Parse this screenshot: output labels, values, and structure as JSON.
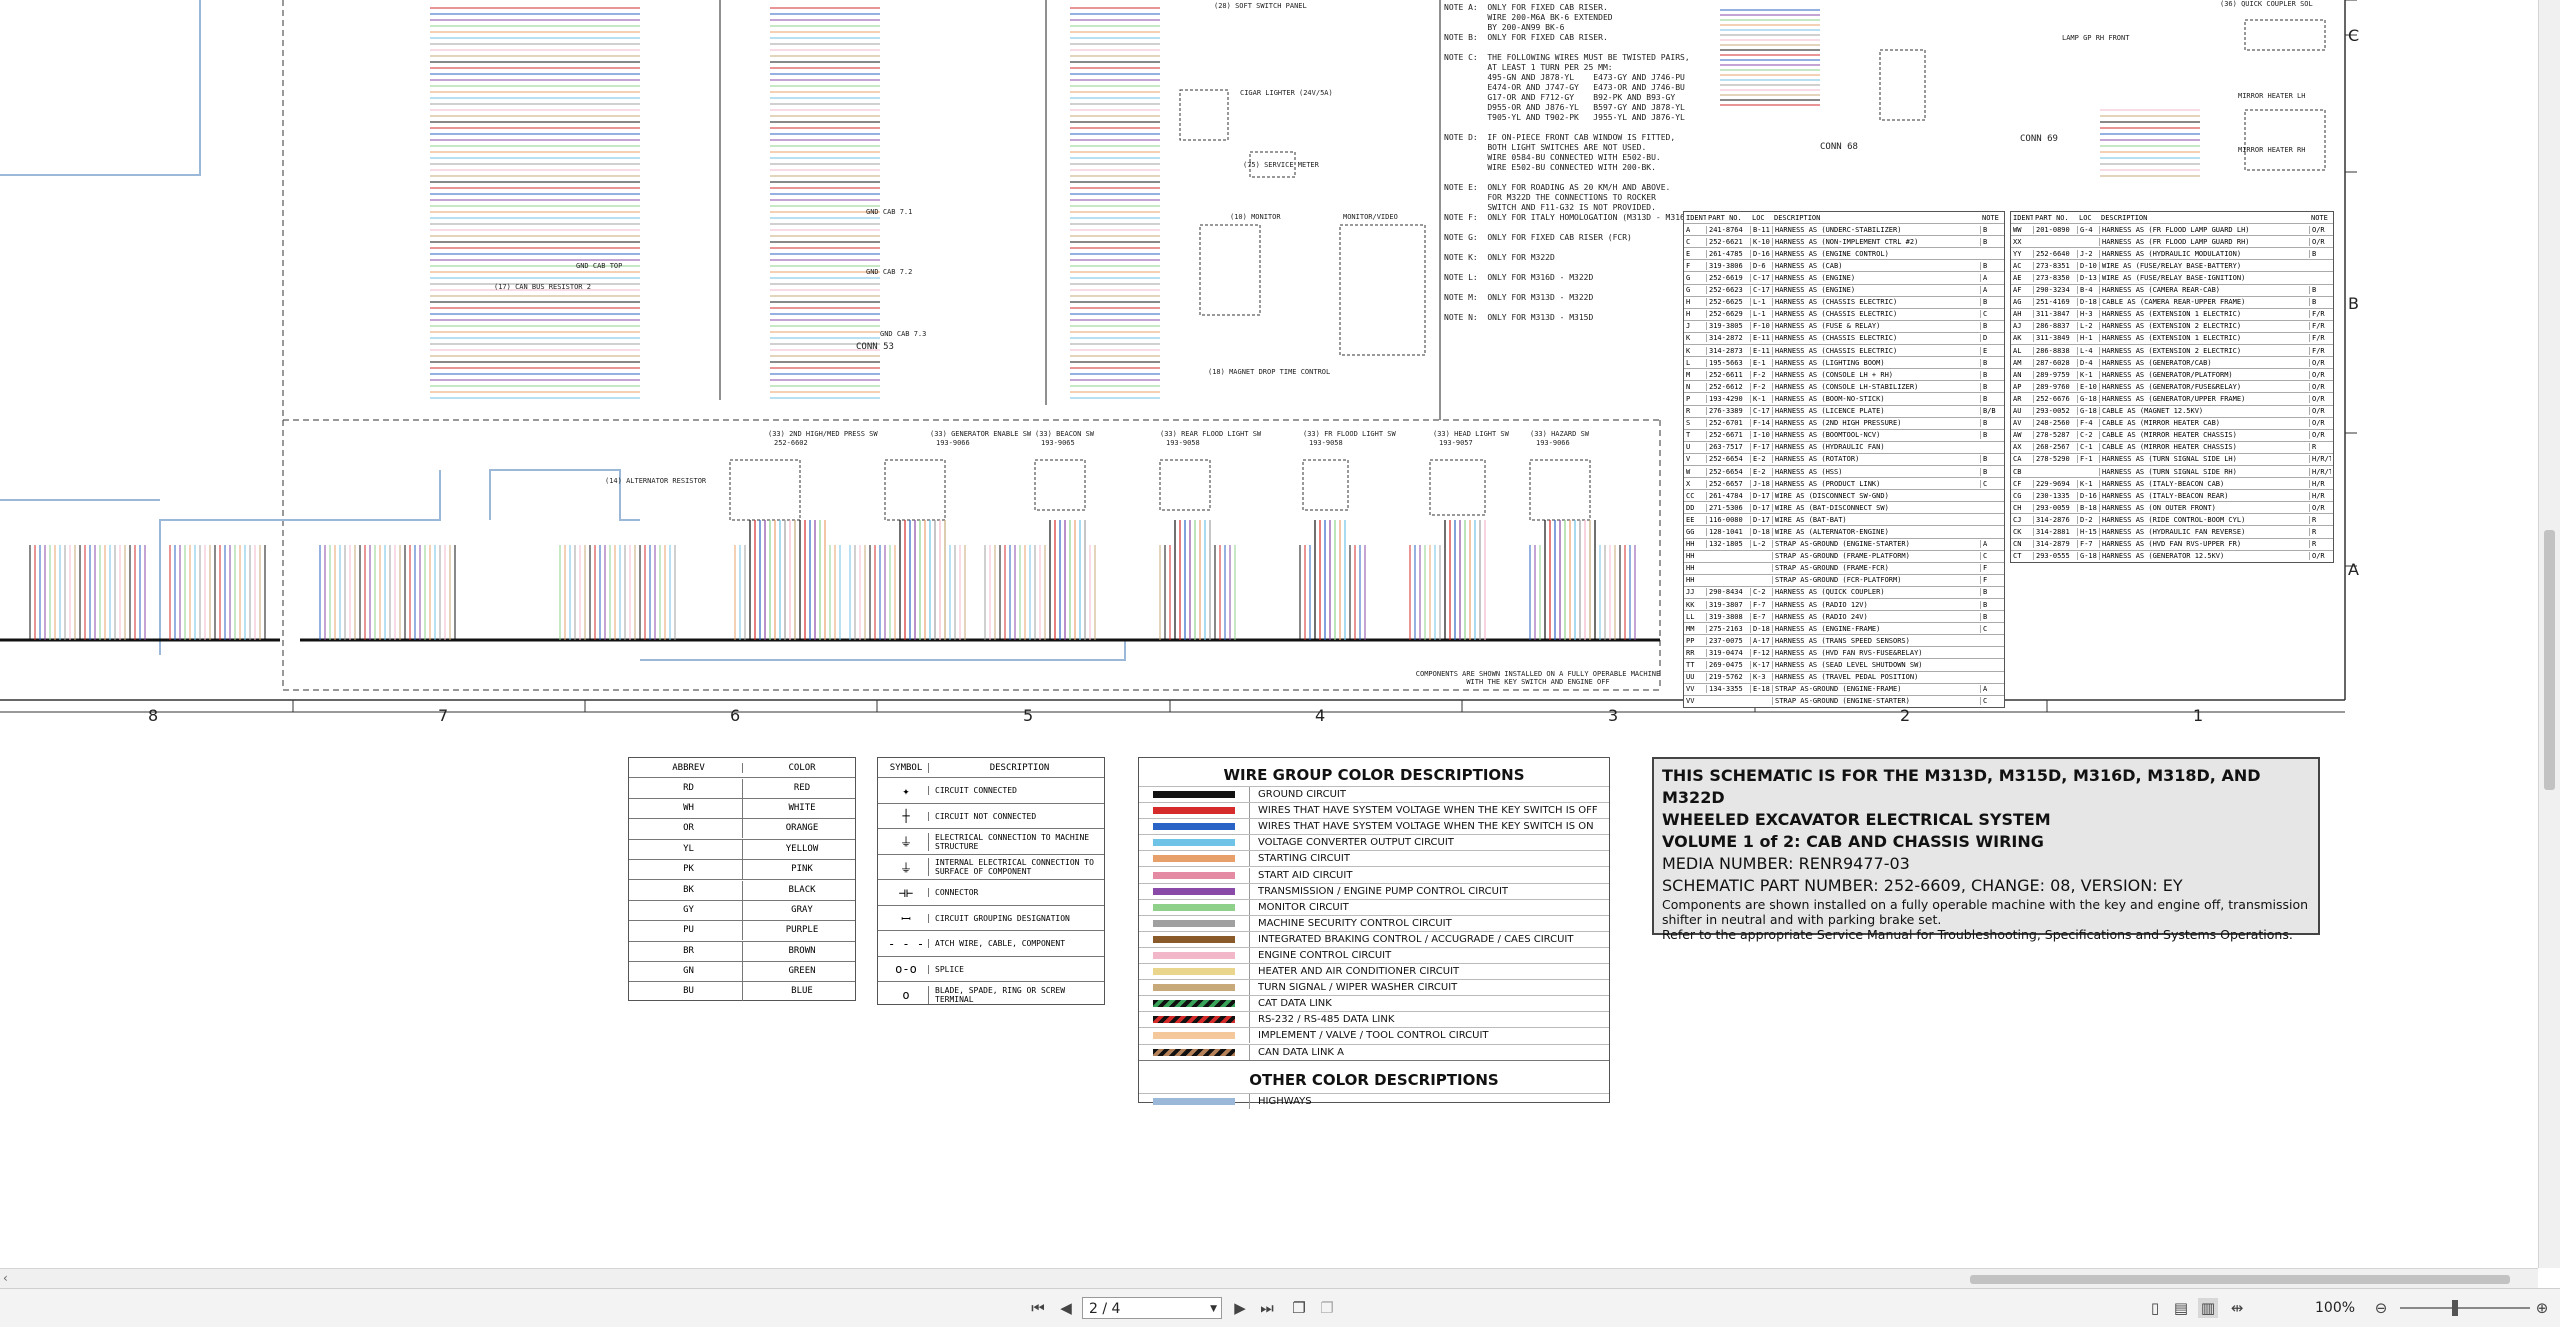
{
  "title_block": {
    "line1": "THIS SCHEMATIC IS FOR THE M313D, M315D, M316D, M318D, AND M322D",
    "line2": "WHEELED EXCAVATOR ELECTRICAL SYSTEM",
    "line3": "VOLUME 1 of 2: CAB AND CHASSIS WIRING",
    "media": "MEDIA NUMBER: RENR9477-03",
    "part": "SCHEMATIC PART NUMBER: 252-6609, CHANGE: 08, VERSION: EY",
    "note1": "Components are shown installed on a fully operable machine with the key and engine off, transmission shifter in neutral and with parking brake set.",
    "note2": "Refer to the appropriate Service Manual for Troubleshooting, Specifications and Systems Operations."
  },
  "wire_group": {
    "heading": "WIRE GROUP COLOR DESCRIPTIONS",
    "items": [
      {
        "color": "#111111",
        "label": "GROUND CIRCUIT"
      },
      {
        "color": "#d52b2b",
        "label": "WIRES THAT HAVE SYSTEM VOLTAGE WHEN THE KEY SWITCH IS OFF"
      },
      {
        "color": "#2a63c6",
        "label": "WIRES THAT HAVE SYSTEM VOLTAGE WHEN THE KEY SWITCH IS ON"
      },
      {
        "color": "#6fc3e6",
        "label": "VOLTAGE CONVERTER OUTPUT CIRCUIT"
      },
      {
        "color": "#e8a06a",
        "label": "STARTING CIRCUIT"
      },
      {
        "color": "#e58aa3",
        "label": "START AID CIRCUIT"
      },
      {
        "color": "#8a4aa8",
        "label": "TRANSMISSION / ENGINE PUMP CONTROL CIRCUIT"
      },
      {
        "color": "#8fd18a",
        "label": "MONITOR CIRCUIT"
      },
      {
        "color": "#a0a0a0",
        "label": "MACHINE SECURITY CONTROL CIRCUIT"
      },
      {
        "color": "#8b5a2b",
        "label": "INTEGRATED BRAKING CONTROL / ACCUGRADE / CAES CIRCUIT"
      },
      {
        "color": "#f2b7c8",
        "label": "ENGINE CONTROL CIRCUIT"
      },
      {
        "color": "#e9d58c",
        "label": "HEATER AND AIR CONDITIONER CIRCUIT"
      },
      {
        "color": "#c8a97a",
        "label": "TURN SIGNAL / WIPER WASHER CIRCUIT"
      },
      {
        "color": "stripe-green",
        "label": "CAT DATA LINK"
      },
      {
        "color": "stripe-red",
        "label": "RS-232 / RS-485 DATA LINK"
      },
      {
        "color": "#f4c89a",
        "label": "IMPLEMENT / VALVE / TOOL CONTROL CIRCUIT"
      },
      {
        "color": "stripe-brown",
        "label": "CAN DATA LINK A"
      }
    ],
    "other_heading": "OTHER COLOR DESCRIPTIONS",
    "other_items": [
      {
        "color": "#9bb8d8",
        "label": "HIGHWAYS"
      }
    ]
  },
  "abbrev_table": {
    "headers": [
      "ABBREV",
      "COLOR"
    ],
    "rows": [
      [
        "RD",
        "RED"
      ],
      [
        "WH",
        "WHITE"
      ],
      [
        "OR",
        "ORANGE"
      ],
      [
        "YL",
        "YELLOW"
      ],
      [
        "PK",
        "PINK"
      ],
      [
        "BK",
        "BLACK"
      ],
      [
        "GY",
        "GRAY"
      ],
      [
        "PU",
        "PURPLE"
      ],
      [
        "BR",
        "BROWN"
      ],
      [
        "GN",
        "GREEN"
      ],
      [
        "BU",
        "BLUE"
      ]
    ]
  },
  "symbol_table": {
    "headers": [
      "SYMBOL",
      "DESCRIPTION"
    ],
    "rows": [
      {
        "sym": "✦",
        "desc": "CIRCUIT CONNECTED"
      },
      {
        "sym": "┼",
        "desc": "CIRCUIT NOT CONNECTED"
      },
      {
        "sym": "⏚",
        "desc": "ELECTRICAL CONNECTION TO MACHINE STRUCTURE"
      },
      {
        "sym": "⏚",
        "desc": "INTERNAL ELECTRICAL CONNECTION TO SURFACE OF COMPONENT"
      },
      {
        "sym": "⊣⊢",
        "desc": "CONNECTOR"
      },
      {
        "sym": "ꟷ",
        "desc": "CIRCUIT GROUPING DESIGNATION"
      },
      {
        "sym": "- - -",
        "desc": "ATCH WIRE, CABLE, COMPONENT"
      },
      {
        "sym": "o-o",
        "desc": "SPLICE"
      },
      {
        "sym": "o",
        "desc": "BLADE, SPADE, RING OR SCREW TERMINAL"
      }
    ]
  },
  "grid": {
    "columns": [
      "8",
      "7",
      "6",
      "5",
      "4",
      "3",
      "2",
      "1"
    ],
    "rows": [
      "C",
      "B",
      "A"
    ]
  },
  "harness_table_left": {
    "headers": [
      "IDENT",
      "PART NO.",
      "LOC",
      "DESCRIPTION",
      "NOTE"
    ],
    "rows": [
      [
        "A",
        "241-8764",
        "B-11",
        "HARNESS AS (UNDERC-STABILIZER)",
        "B"
      ],
      [
        "C",
        "252-6621",
        "K-10",
        "HARNESS AS (NON-IMPLEMENT CTRL #2)",
        "B"
      ],
      [
        "E",
        "261-4785",
        "D-16",
        "HARNESS AS (ENGINE CONTROL)",
        ""
      ],
      [
        "F",
        "319-3806",
        "D-6",
        "HARNESS AS (CAB)",
        "B"
      ],
      [
        "G",
        "252-6619",
        "C-17",
        "HARNESS AS (ENGINE)",
        "A"
      ],
      [
        "G",
        "252-6623",
        "C-17",
        "HARNESS AS (ENGINE)",
        "A"
      ],
      [
        "H",
        "252-6625",
        "L-1",
        "HARNESS AS (CHASSIS ELECTRIC)",
        "B"
      ],
      [
        "H",
        "252-6629",
        "L-1",
        "HARNESS AS (CHASSIS ELECTRIC)",
        "C"
      ],
      [
        "J",
        "319-3805",
        "F-10",
        "HARNESS AS (FUSE & RELAY)",
        "B"
      ],
      [
        "K",
        "314-2872",
        "E-11",
        "HARNESS AS (CHASSIS ELECTRIC)",
        "D"
      ],
      [
        "K",
        "314-2873",
        "E-11",
        "HARNESS AS (CHASSIS ELECTRIC)",
        "E"
      ],
      [
        "L",
        "195-5663",
        "E-1",
        "HARNESS AS (LIGHTING BOOM)",
        "B"
      ],
      [
        "M",
        "252-6611",
        "F-2",
        "HARNESS AS (CONSOLE LH + RH)",
        "B"
      ],
      [
        "N",
        "252-6612",
        "F-2",
        "HARNESS AS (CONSOLE LH-STABILIZER)",
        "B"
      ],
      [
        "P",
        "193-4290",
        "K-1",
        "HARNESS AS (BOOM-NO-STICK)",
        "B"
      ],
      [
        "R",
        "276-3389",
        "C-17",
        "HARNESS AS (LICENCE PLATE)",
        "B/B"
      ],
      [
        "S",
        "252-6701",
        "F-14",
        "HARNESS AS (2ND HIGH PRESSURE)",
        "B"
      ],
      [
        "T",
        "252-6671",
        "I-10",
        "HARNESS AS (BOOMTOOL-NCV)",
        "B"
      ],
      [
        "U",
        "263-7517",
        "F-17",
        "HARNESS AS (HYDRAULIC FAN)",
        ""
      ],
      [
        "V",
        "252-6654",
        "E-2",
        "HARNESS AS (ROTATOR)",
        "B"
      ],
      [
        "W",
        "252-6654",
        "E-2",
        "HARNESS AS (HSS)",
        "B"
      ],
      [
        "X",
        "252-6657",
        "J-18",
        "HARNESS AS (PRODUCT LINK)",
        "C"
      ],
      [
        "CC",
        "261-4784",
        "D-17",
        "WIRE AS (DISCONNECT SW-GND)",
        ""
      ],
      [
        "DD",
        "271-5306",
        "D-17",
        "WIRE AS (BAT-DISCONNECT SW)",
        ""
      ],
      [
        "EE",
        "116-0080",
        "D-17",
        "WIRE AS (BAT-BAT)",
        ""
      ],
      [
        "GG",
        "128-1041",
        "D-18",
        "WIRE AS (ALTERNATOR-ENGINE)",
        ""
      ],
      [
        "HH",
        "132-1805",
        "L-2",
        "STRAP AS-GROUND (ENGINE-STARTER)",
        "A"
      ],
      [
        "HH",
        "",
        "",
        "STRAP AS-GROUND (FRAME-PLATFORM)",
        "C"
      ],
      [
        "HH",
        "",
        "",
        "STRAP AS-GROUND (FRAME-FCR)",
        "F"
      ],
      [
        "HH",
        "",
        "",
        "STRAP AS-GROUND (FCR-PLATFORM)",
        "F"
      ],
      [
        "JJ",
        "290-8434",
        "C-2",
        "HARNESS AS (QUICK COUPLER)",
        "B"
      ],
      [
        "KK",
        "319-3807",
        "F-7",
        "HARNESS AS (RADIO 12V)",
        "B"
      ],
      [
        "LL",
        "319-3808",
        "E-7",
        "HARNESS AS (RADIO 24V)",
        "B"
      ],
      [
        "MM",
        "275-2163",
        "D-18",
        "HARNESS AS (ENGINE-FRAME)",
        "C"
      ],
      [
        "PP",
        "237-0075",
        "A-17",
        "HARNESS AS (TRANS SPEED SENSORS)",
        ""
      ],
      [
        "RR",
        "319-0474",
        "F-12",
        "HARNESS AS (HVD FAN RVS-FUSE&RELAY)",
        ""
      ],
      [
        "TT",
        "269-0475",
        "K-17",
        "HARNESS AS (SEAD LEVEL SHUTDOWN SW)",
        ""
      ],
      [
        "UU",
        "219-5762",
        "K-3",
        "HARNESS AS (TRAVEL PEDAL POSITION)",
        ""
      ],
      [
        "VV",
        "134-3355",
        "E-18",
        "STRAP AS-GROUND (ENGINE-FRAME)",
        "A"
      ],
      [
        "VV",
        "",
        "",
        "STRAP AS-GROUND (ENGINE-STARTER)",
        "C"
      ]
    ]
  },
  "harness_table_right": {
    "headers": [
      "IDENT",
      "PART NO.",
      "LOC",
      "DESCRIPTION",
      "NOTE"
    ],
    "rows": [
      [
        "WW",
        "201-0890",
        "G-4",
        "HARNESS AS (FR FLOOD LAMP GUARD LH)",
        "O/R"
      ],
      [
        "XX",
        "",
        "",
        "HARNESS AS (FR FLOOD LAMP GUARD RH)",
        "O/R"
      ],
      [
        "YY",
        "252-6640",
        "J-2",
        "HARNESS AS (HYDRAULIC MODULATION)",
        "B"
      ],
      [
        "AC",
        "273-8351",
        "D-10",
        "WIRE AS (FUSE/RELAY BASE-BATTERY)",
        ""
      ],
      [
        "AE",
        "273-8350",
        "D-13",
        "WIRE AS (FUSE/RELAY BASE-IGNITION)",
        ""
      ],
      [
        "AF",
        "290-3234",
        "B-4",
        "HARNESS AS (CAMERA REAR-CAB)",
        "B"
      ],
      [
        "AG",
        "251-4169",
        "D-18",
        "CABLE AS (CAMERA REAR-UPPER FRAME)",
        "B"
      ],
      [
        "AH",
        "311-3847",
        "H-3",
        "HARNESS AS (EXTENSION 1 ELECTRIC)",
        "F/R"
      ],
      [
        "AJ",
        "286-8837",
        "L-2",
        "HARNESS AS (EXTENSION 2 ELECTRIC)",
        "F/R"
      ],
      [
        "AK",
        "311-3849",
        "H-1",
        "HARNESS AS (EXTENSION 1 ELECTRIC)",
        "F/R"
      ],
      [
        "AL",
        "286-8838",
        "L-4",
        "HARNESS AS (EXTENSION 2 ELECTRIC)",
        "F/R"
      ],
      [
        "AM",
        "287-6028",
        "D-4",
        "HARNESS AS (GENERATOR/CAB)",
        "O/R"
      ],
      [
        "AN",
        "289-9759",
        "K-1",
        "HARNESS AS (GENERATOR/PLATFORM)",
        "O/R"
      ],
      [
        "AP",
        "289-9760",
        "E-10",
        "HARNESS AS (GENERATOR/FUSE&RELAY)",
        "O/R"
      ],
      [
        "AR",
        "252-6676",
        "G-18",
        "HARNESS AS (GENERATOR/UPPER FRAME)",
        "O/R"
      ],
      [
        "AU",
        "293-0052",
        "G-18",
        "CABLE AS (MAGNET 12.5KV)",
        "O/R"
      ],
      [
        "AV",
        "248-2560",
        "F-4",
        "CABLE AS (MIRROR HEATER CAB)",
        "O/R"
      ],
      [
        "AW",
        "278-5287",
        "C-2",
        "CABLE AS (MIRROR HEATER CHASSIS)",
        "O/R"
      ],
      [
        "AX",
        "268-2567",
        "C-1",
        "CABLE AS (MIRROR HEATER CHASSIS)",
        "R"
      ],
      [
        "CA",
        "278-5290",
        "F-1",
        "HARNESS AS (TURN SIGNAL SIDE LH)",
        "H/R/T"
      ],
      [
        "CB",
        "",
        "",
        "HARNESS AS (TURN SIGNAL SIDE RH)",
        "H/R/T"
      ],
      [
        "CF",
        "229-9694",
        "K-1",
        "HARNESS AS (ITALY-BEACON CAB)",
        "H/R"
      ],
      [
        "CG",
        "230-1335",
        "D-16",
        "HARNESS AS (ITALY-BEACON REAR)",
        "H/R"
      ],
      [
        "CH",
        "293-0059",
        "B-18",
        "HARNESS AS (ON OUTER FRONT)",
        "O/R"
      ],
      [
        "CJ",
        "314-2876",
        "D-2",
        "HARNESS AS (RIDE CONTROL-BOOM CYL)",
        "R"
      ],
      [
        "CK",
        "314-2881",
        "H-15",
        "HARNESS AS (HYDRAULIC FAN REVERSE)",
        "R"
      ],
      [
        "CN",
        "314-2879",
        "F-7",
        "HARNESS AS (HVD FAN RVS-UPPER FR)",
        "R"
      ],
      [
        "CT",
        "293-0555",
        "G-18",
        "HARNESS AS (GENERATOR 12.5KV)",
        "O/R"
      ]
    ]
  },
  "general_notes": "NOTE A:  ONLY FOR FIXED CAB RISER.\n         WIRE 200-M6A BK-6 EXTENDED\n         BY 200-AN99 BK-6\nNOTE B:  ONLY FOR FIXED CAB RISER.\n\nNOTE C:  THE FOLLOWING WIRES MUST BE TWISTED PAIRS,\n         AT LEAST 1 TURN PER 25 MM:\n         495-GN AND J878-YL    E473-GY AND J746-PU\n         E474-OR AND J747-GY   E473-OR AND J746-BU\n         G17-OR AND F712-GY    B92-PK AND B93-GY\n         D955-OR AND J876-YL   B597-GY AND J878-YL\n         T905-YL AND T902-PK   J955-YL AND J876-YL\n\nNOTE D:  IF ON-PIECE FRONT CAB WINDOW IS FITTED,\n         BOTH LIGHT SWITCHES ARE NOT USED.\n         WIRE 0584-BU CONNECTED WITH E502-BU.\n         WIRE E502-BU CONNECTED WITH 200-BK.\n\nNOTE E:  ONLY FOR ROADING AS 20 KM/H AND ABOVE.\n         FOR M322D THE CONNECTIONS TO ROCKER\n         SWITCH AND F11-G32 IS NOT PROVIDED.\nNOTE F:  ONLY FOR ITALY HOMOLOGATION (M313D - M316D)\n\nNOTE G:  ONLY FOR FIXED CAB RISER (FCR)\n\nNOTE K:  ONLY FOR M322D\n\nNOTE L:  ONLY FOR M316D - M322D\n\nNOTE M:  ONLY FOR M313D - M322D\n\nNOTE N:  ONLY FOR M313D - M315D",
  "switch_labels": [
    {
      "title": "(33) 2ND HIGH/MED PRESS SW",
      "part": "252-6602"
    },
    {
      "title": "(33) GENERATOR ENABLE SW",
      "part": "193-9066"
    },
    {
      "title": "(33) BEACON SW",
      "part": "193-9065"
    },
    {
      "title": "(33) REAR FLOOD LIGHT SW",
      "part": "193-9058"
    },
    {
      "title": "(33) FR FLOOD LIGHT SW",
      "part": "193-9058"
    },
    {
      "title": "(33) HEAD LIGHT SW",
      "part": "193-9057"
    },
    {
      "title": "(33) HAZARD SW",
      "part": "193-9066"
    }
  ],
  "misc_labels": {
    "conn53": "CONN 53",
    "conn68": "CONN 68",
    "conn69": "CONN 69",
    "components_note": "COMPONENTS ARE SHOWN INSTALLED ON A FULLY OPERABLE MACHINE WITH THE KEY SWITCH AND ENGINE OFF",
    "cigar": "CIGAR LIGHTER (24V/5A)",
    "service_meter": "(75) SERVICE METER",
    "monitor": "(10) MONITOR",
    "monitor_video": "MONITOR/VIDEO",
    "alt_resistor": "(14) ALTERNATOR RESISTOR",
    "can_bus": "(17) CAN BUS RESISTOR 2",
    "magnet": "(18) MAGNET DROP TIME CONTROL",
    "lamp_front": "LAMP GP RH FRONT",
    "quick_coupler": "(36) QUICK COUPLER SOL",
    "mirror_lh": "MIRROR HEATER LH",
    "mirror_rh": "MIRROR HEATER RH",
    "soft_switch": "(28) SOFT SWITCH PANEL",
    "gnd_cab_top": "GND CAB TOP",
    "gnd_cab_71": "GND CAB 7.1",
    "gnd_cab_72": "GND CAB 7.2",
    "gnd_cab_73": "GND CAB 7.3"
  },
  "toolbar": {
    "page_value": "2 / 4",
    "zoom": "100%"
  }
}
